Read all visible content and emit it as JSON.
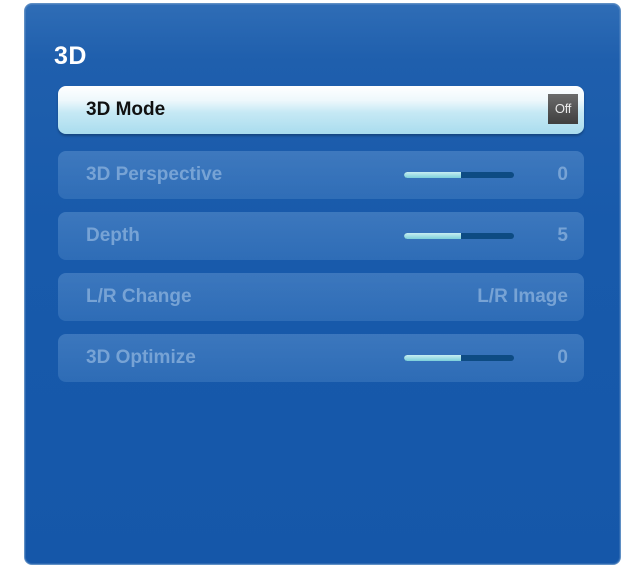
{
  "menu": {
    "title": "3D",
    "items": [
      {
        "label": "3D Mode",
        "value": "Off",
        "selected": true
      },
      {
        "label": "3D Perspective",
        "value": "0",
        "slider_fraction": 0.52
      },
      {
        "label": "Depth",
        "value": "5",
        "slider_fraction": 0.52
      },
      {
        "label": "L/R Change",
        "value": "L/R Image"
      },
      {
        "label": "3D Optimize",
        "value": "0",
        "slider_fraction": 0.52
      }
    ]
  },
  "colors": {
    "panel_blue": "#1858aa",
    "selected_highlight": "#c6e9f5",
    "dim_text": "#77a3d5",
    "slider_track": "#0d4b83",
    "slider_fill": "#7ccfda"
  }
}
